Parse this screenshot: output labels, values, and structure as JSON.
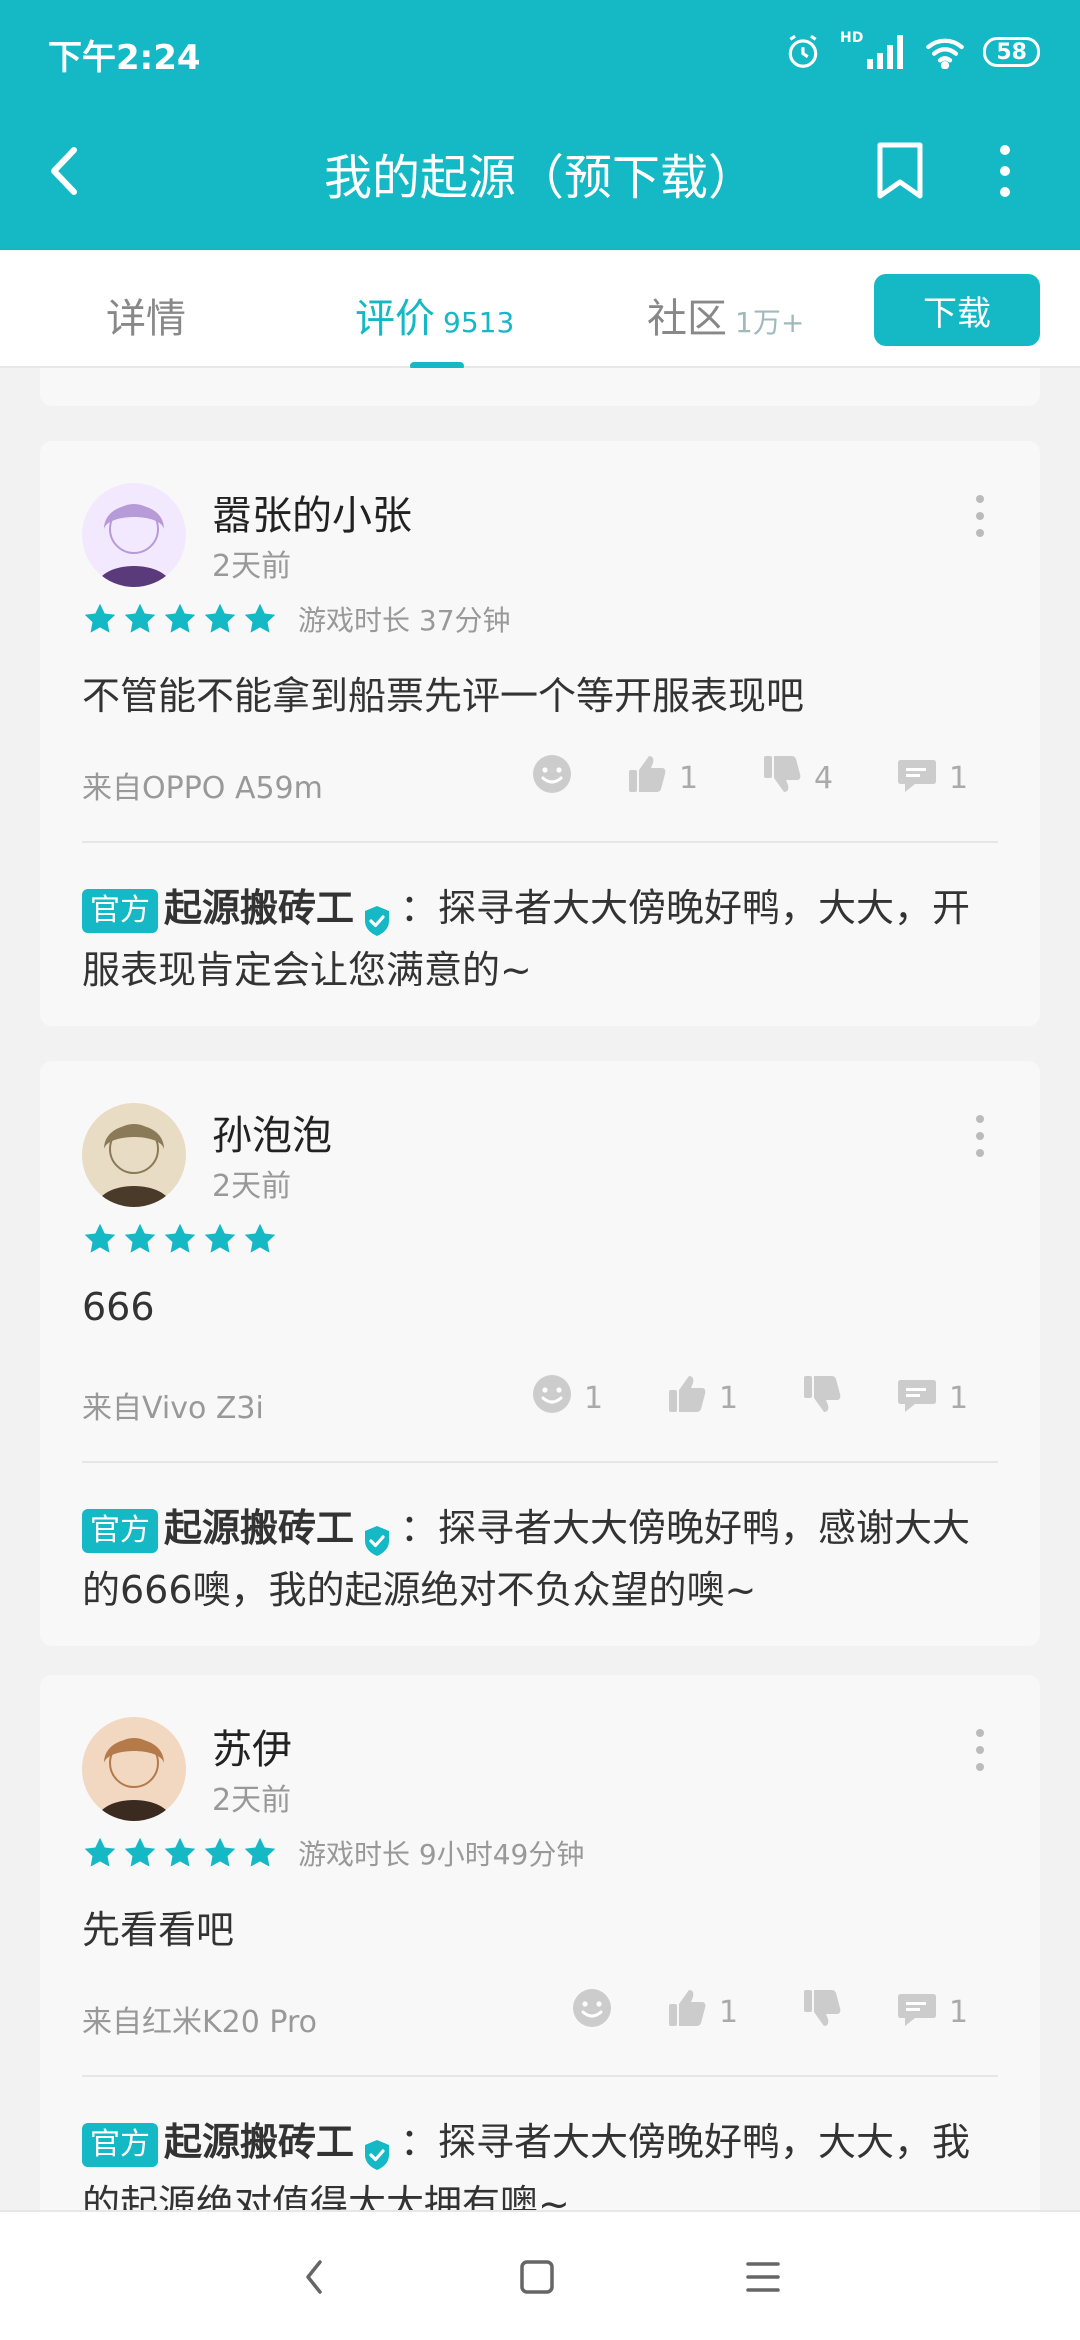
{
  "status_bar": {
    "time": "下午2:24",
    "signal_label": "HD",
    "battery": "58"
  },
  "nav": {
    "title": "我的起源（预下载）"
  },
  "tabs": [
    {
      "label": "详情",
      "count": ""
    },
    {
      "label": "评价",
      "count": "9513"
    },
    {
      "label": "社区",
      "count": "1万+"
    }
  ],
  "download_label": "下载",
  "colors": {
    "accent": "#15b8c5",
    "star": "#15b8c5",
    "text_muted": "#999999"
  },
  "reviews": [
    {
      "user": "嚣张的小张",
      "time": "2天前",
      "stars": 5,
      "playtime": "游戏时长 37分钟",
      "text": "不管能不能拿到船票先评一个等开服表现吧",
      "device": "来自OPPO A59m",
      "emoji_count": "",
      "like_count": "1",
      "dislike_count": "4",
      "comment_count": "1",
      "reply": {
        "badge": "官方",
        "author": "起源搬砖工",
        "text": "：探寻者大大傍晚好鸭，大大，开服表现肯定会让您满意的~"
      }
    },
    {
      "user": "孙泡泡",
      "time": "2天前",
      "stars": 5,
      "playtime": "",
      "text": "666",
      "device": "来自Vivo Z3i",
      "emoji_count": "1",
      "like_count": "1",
      "dislike_count": "",
      "comment_count": "1",
      "reply": {
        "badge": "官方",
        "author": "起源搬砖工",
        "text": "：探寻者大大傍晚好鸭，感谢大大的666噢，我的起源绝对不负众望的噢~"
      }
    },
    {
      "user": "苏伊",
      "time": "2天前",
      "stars": 5,
      "playtime": "游戏时长 9小时49分钟",
      "text": "先看看吧",
      "device": "来自红米K20 Pro",
      "emoji_count": "",
      "like_count": "1",
      "dislike_count": "",
      "comment_count": "1",
      "reply": {
        "badge": "官方",
        "author": "起源搬砖工",
        "text": "：探寻者大大傍晚好鸭，大大，我的起源绝对值得大大拥有噢~"
      }
    }
  ]
}
